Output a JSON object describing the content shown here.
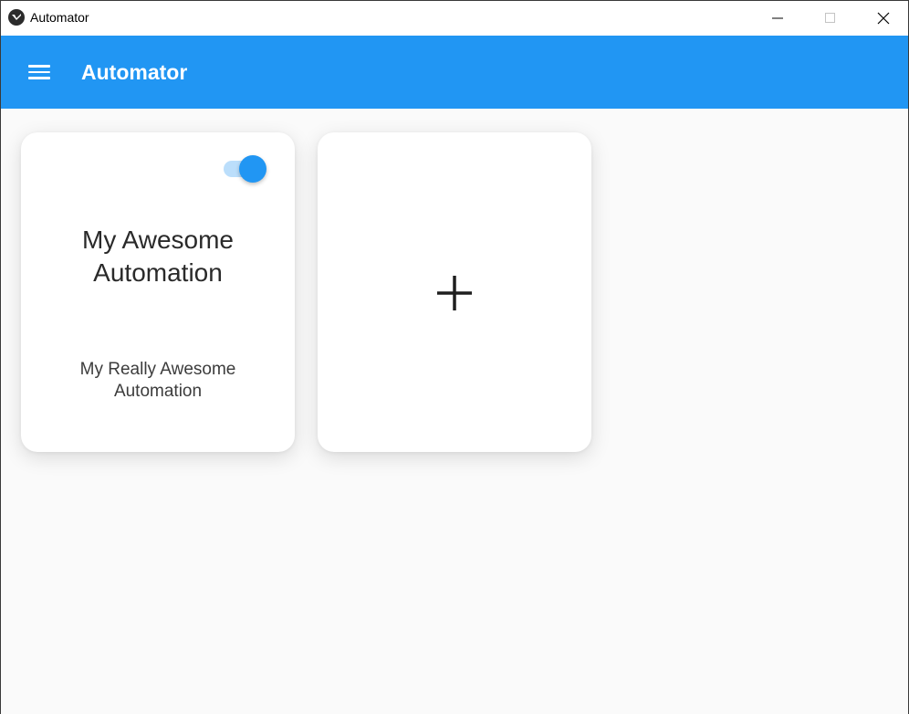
{
  "window": {
    "title": "Automator",
    "icon": "kivy-logo-icon",
    "controls": [
      "minimize-icon",
      "maximize-icon",
      "close-icon"
    ]
  },
  "appbar": {
    "title": "Automator",
    "menu_icon": "hamburger-menu-icon",
    "color": "#2196f3"
  },
  "cards": [
    {
      "title": "My Awesome Automation",
      "subtitle": "My Really Awesome Automation",
      "enabled": true
    }
  ],
  "add_card": {
    "icon": "plus-icon"
  },
  "colors": {
    "accent": "#2196f3",
    "toggle_track": "#bbdefb",
    "background": "#fafafa"
  }
}
